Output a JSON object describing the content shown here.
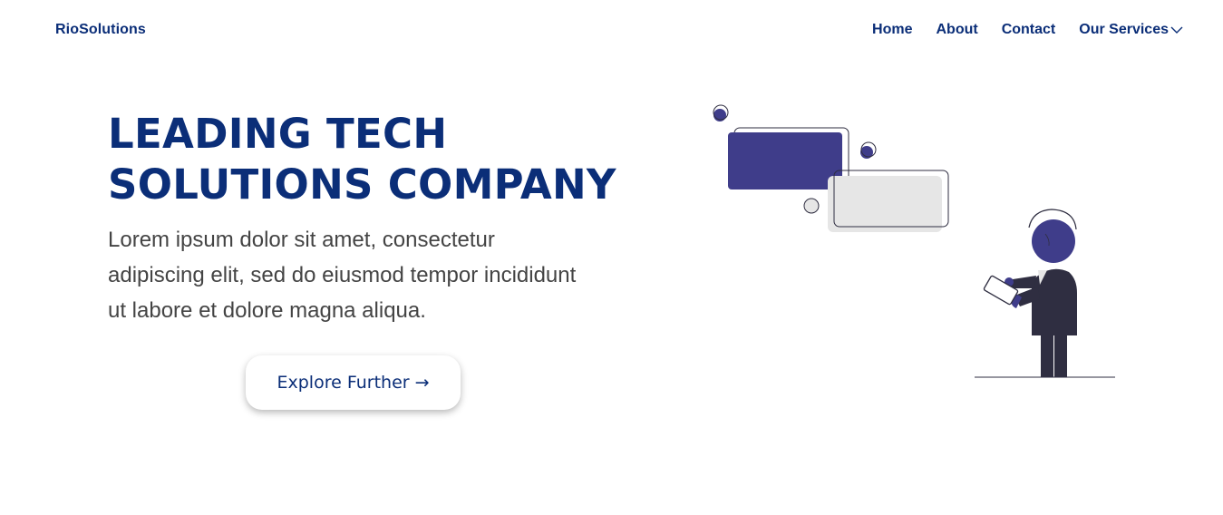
{
  "brand": "RioSolutions",
  "nav": {
    "home": "Home",
    "about": "About",
    "contact": "Contact",
    "services": "Our Services"
  },
  "hero": {
    "title_line1": "LEADING TECH",
    "title_line2": "SOLUTIONS COMPANY",
    "description": "Lorem ipsum dolor sit amet, consectetur adipiscing elit, sed do eiusmod tempor incididunt ut labore et dolore magna aliqua.",
    "cta_label": "Explore Further",
    "cta_icon": "arrow-right-icon"
  },
  "colors": {
    "brand_blue": "#0b2e78",
    "accent_purple": "#3f3d8a",
    "dark_suit": "#2f2e41",
    "light_gray": "#e6e6e6",
    "body_text": "#444444"
  }
}
